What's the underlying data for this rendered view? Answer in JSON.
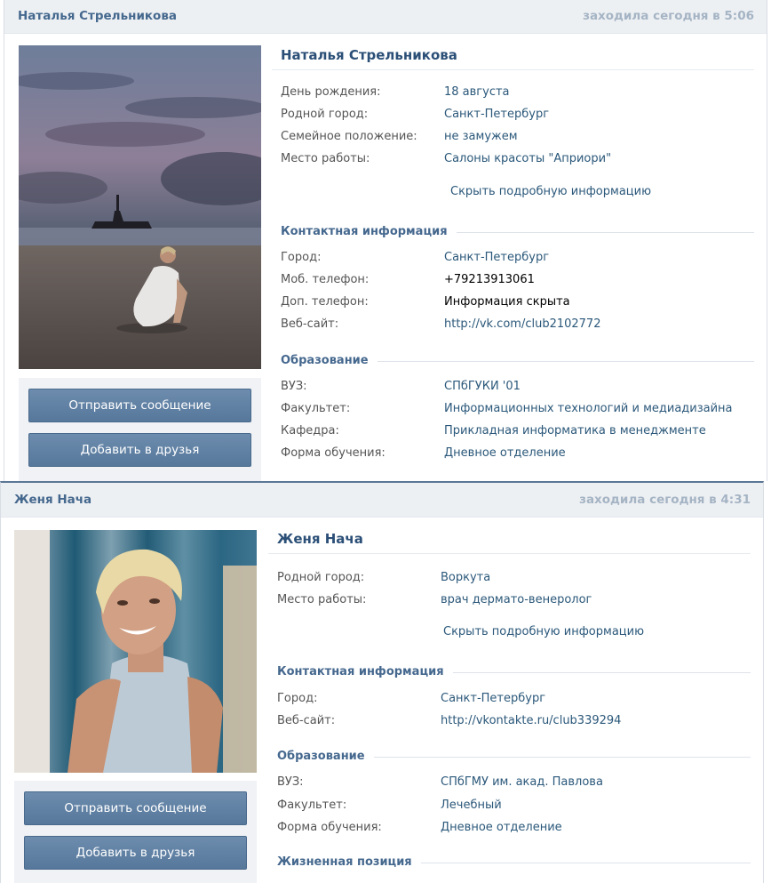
{
  "profiles": [
    {
      "header": {
        "name": "Наталья Стрельникова",
        "status": "заходила сегодня в 5:06"
      },
      "title": "Наталья Стрельникова",
      "basic": [
        {
          "label": "День рождения:",
          "value": "18 августа"
        },
        {
          "label": "Родной город:",
          "value": "Санкт-Петербург"
        },
        {
          "label": "Семейное положение:",
          "value": "не замужем"
        },
        {
          "label": "Место работы:",
          "value": "Салоны красоты \"Априори\""
        }
      ],
      "hide_link": "Скрыть подробную информацию",
      "contacts_title": "Контактная информация",
      "contacts": [
        {
          "label": "Город:",
          "value": "Санкт-Петербург"
        },
        {
          "label": "Моб. телефон:",
          "value": "+79213913061"
        },
        {
          "label": "Доп. телефон:",
          "value": "Информация скрыта"
        },
        {
          "label": "Веб-сайт:",
          "value": "http://vk.com/club2102772"
        }
      ],
      "education_title": "Образование",
      "education": [
        {
          "label": "ВУЗ:",
          "value": "СПбГУКИ '01"
        },
        {
          "label": "Факультет:",
          "value": "Информационных технологий и медиадизайна"
        },
        {
          "label": "Кафедра:",
          "value": "Прикладная информатика в менеджменте"
        },
        {
          "label": "Форма обучения:",
          "value": "Дневное отделение"
        }
      ],
      "send_message": "Отправить сообщение",
      "add_friend": "Добавить в друзья"
    },
    {
      "header": {
        "name": "Женя Нача",
        "status": "заходила сегодня в 4:31"
      },
      "title": "Женя Нача",
      "basic": [
        {
          "label": "Родной город:",
          "value": "Воркута"
        },
        {
          "label": "Место работы:",
          "value": "врач дермато-венеролог"
        }
      ],
      "hide_link": "Скрыть подробную информацию",
      "contacts_title": "Контактная информация",
      "contacts": [
        {
          "label": "Город:",
          "value": "Санкт-Петербург"
        },
        {
          "label": "Веб-сайт:",
          "value": "http://vkontakte.ru/club339294"
        }
      ],
      "education_title": "Образование",
      "education": [
        {
          "label": "ВУЗ:",
          "value": "СПбГМУ им. акад. Павлова"
        },
        {
          "label": "Факультет:",
          "value": "Лечебный"
        },
        {
          "label": "Форма обучения:",
          "value": "Дневное отделение"
        }
      ],
      "life_title": "Жизненная позиция",
      "send_message": "Отправить сообщение",
      "add_friend": "Добавить в друзья"
    }
  ]
}
